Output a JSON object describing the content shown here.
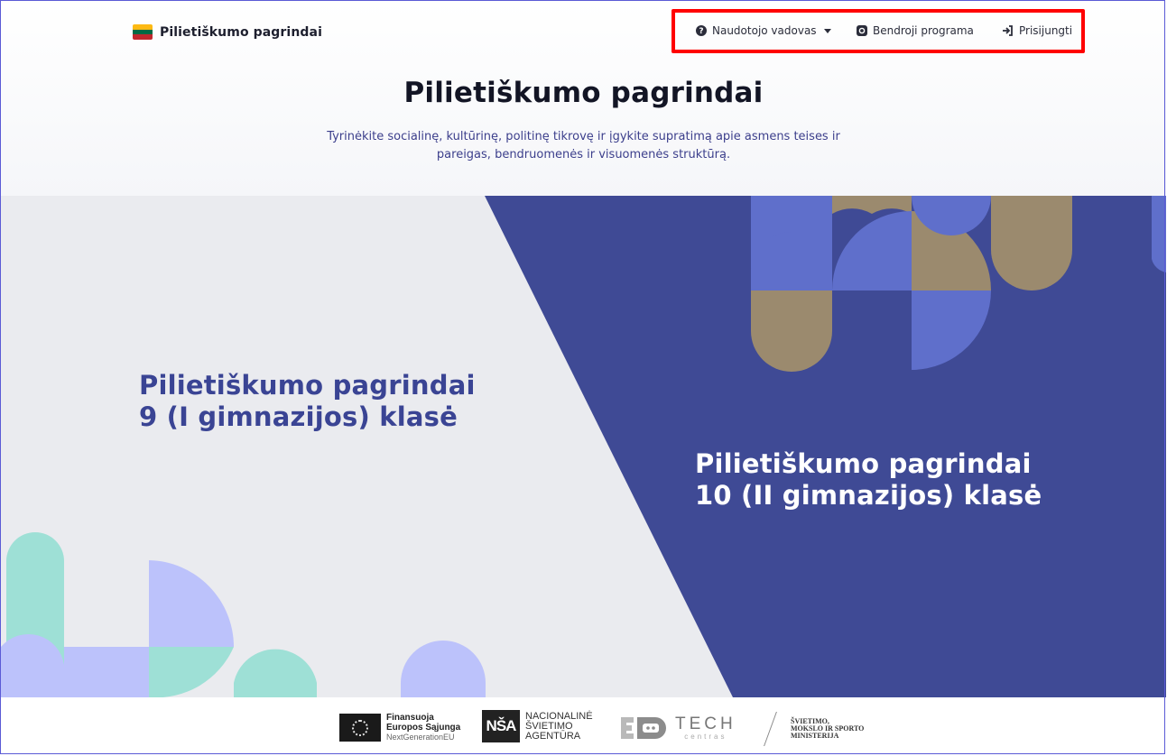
{
  "brand": {
    "name": "Pilietiškumo pagrindai",
    "flag_colors": [
      "#FDB913",
      "#006A44",
      "#C1272D"
    ]
  },
  "nav": {
    "guide": {
      "label": "Naudotojo vadovas",
      "icon": "question-circle-icon"
    },
    "program": {
      "label": "Bendroji programa",
      "icon": "program-icon"
    },
    "login": {
      "label": "Prisijungti",
      "icon": "sign-in-icon"
    }
  },
  "hero": {
    "title": "Pilietiškumo pagrindai",
    "subtitle": "Tyrinėkite socialinę, kultūrinę, politinę tikrovę ir įgykite supratimą apie asmens teises ir pareigas, bendruomenės ir visuomenės struktūrą."
  },
  "panels": {
    "grade9": {
      "line1": "Pilietiškumo pagrindai",
      "line2": "9 (I gimnazijos) klasė"
    },
    "grade10": {
      "line1": "Pilietiškumo pagrindai",
      "line2": "10 (II gimnazijos) klasė"
    }
  },
  "footer": {
    "eu": {
      "line1": "Finansuoja",
      "line2": "Europos Sąjunga",
      "line3": "NextGenerationEU"
    },
    "nsa": {
      "mark": "NŠA",
      "line1": "NACIONALINĖ",
      "line2": "ŠVIETIMO",
      "line3": "AGENTŪRA"
    },
    "edtech": {
      "line1": "TECH",
      "line2": "centras"
    },
    "ministry": {
      "line1": "ŠVIETIMO,",
      "line2": "MOKSLO IR SPORTO",
      "line3": "MINISTERIJA"
    }
  },
  "colors": {
    "accent_dark": "#3f4a95",
    "panel_light": "#eaebef",
    "shape_blue": "#5f6fcb",
    "shape_tan": "#9b8a6e",
    "shape_lavender": "#bcc2fb",
    "shape_mint": "#9ee0d6",
    "highlight": "#ff0000"
  }
}
